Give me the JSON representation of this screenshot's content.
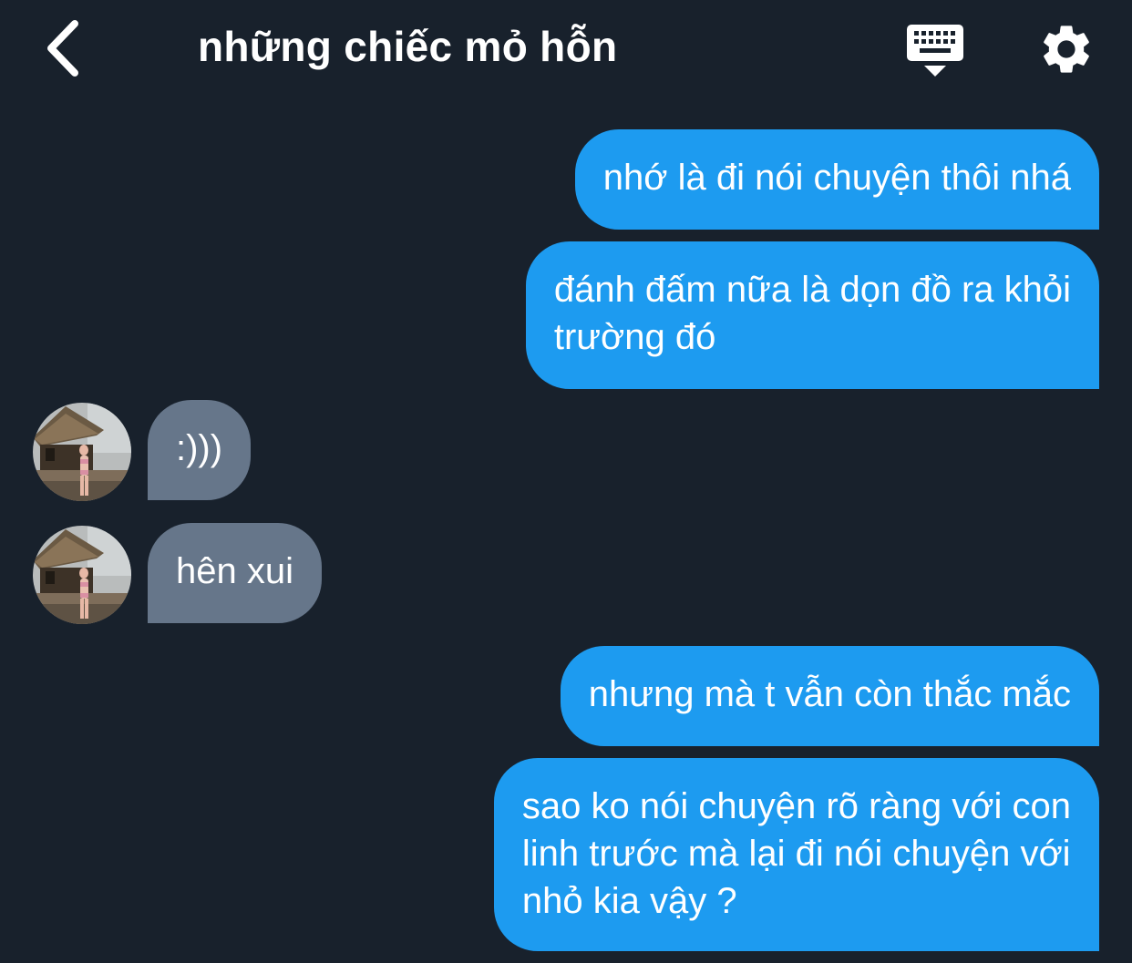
{
  "header": {
    "title": "những chiếc mỏ hỗn",
    "back_icon": "chevron-left-icon",
    "keyboard_icon": "keyboard-icon",
    "settings_icon": "gear-icon"
  },
  "colors": {
    "background": "#18212c",
    "outgoing_bubble": "#1d9bf0",
    "incoming_bubble": "#66768a",
    "text": "#ffffff"
  },
  "messages": [
    {
      "direction": "outgoing",
      "lines": [
        "nhớ là đi nói chuyện thôi nhá"
      ]
    },
    {
      "direction": "outgoing",
      "lines": [
        "đánh đấm nữa là dọn đồ ra khỏi",
        "trường đó"
      ]
    },
    {
      "direction": "incoming",
      "lines": [
        ":)))"
      ]
    },
    {
      "direction": "incoming",
      "lines": [
        "hên xui"
      ]
    },
    {
      "direction": "outgoing",
      "lines": [
        "nhưng mà t vẫn còn thắc mắc"
      ]
    },
    {
      "direction": "outgoing",
      "lines": [
        "sao ko nói chuyện rõ ràng với con",
        "linh trước mà lại đi nói chuyện với",
        "nhỏ kia vậy ?"
      ]
    }
  ]
}
